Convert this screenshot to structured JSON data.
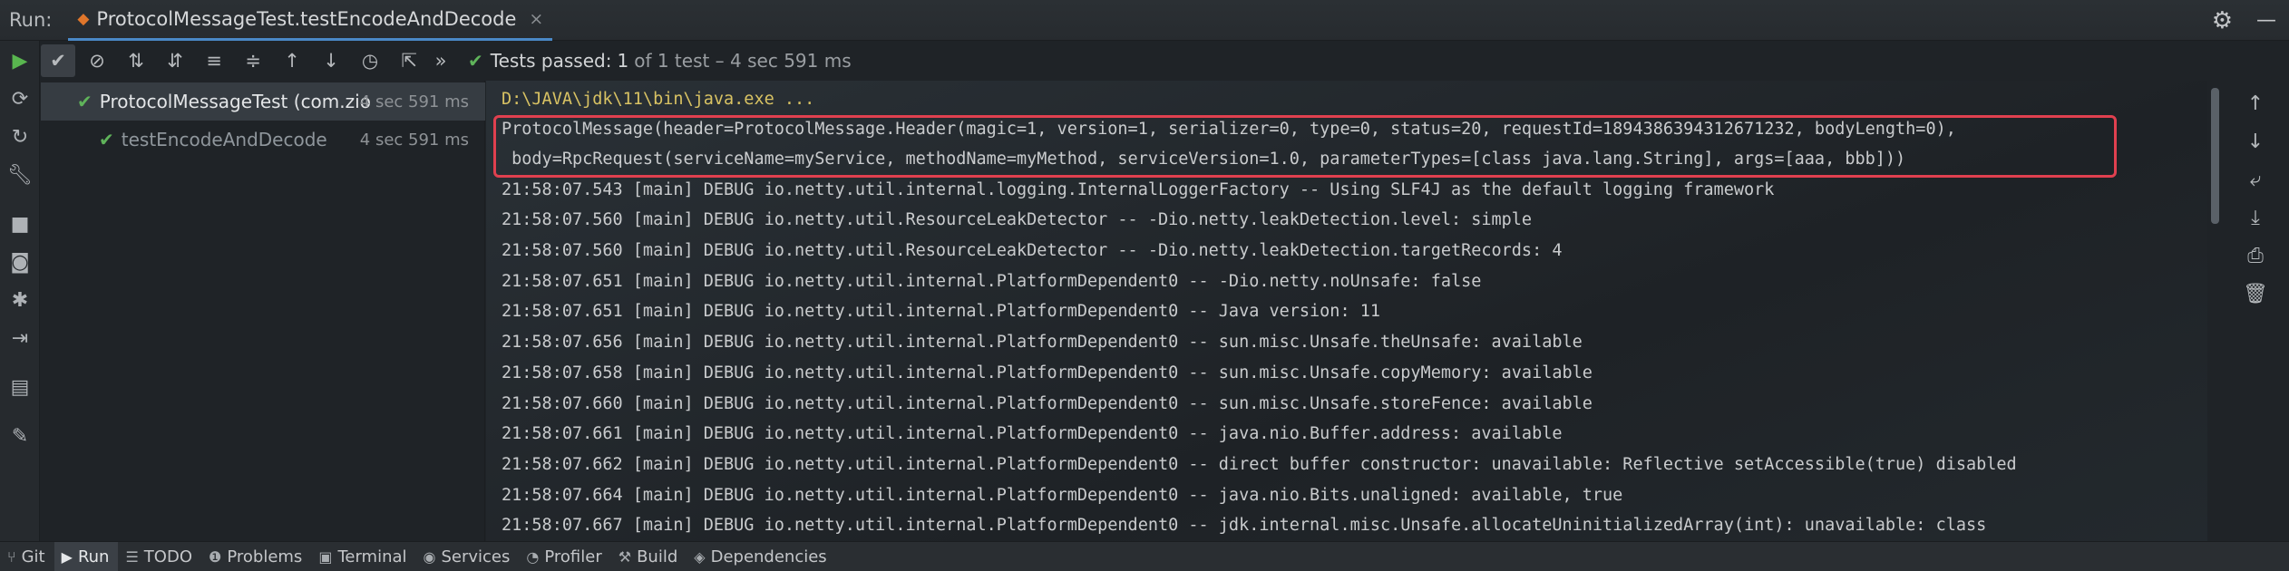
{
  "titlebar": {
    "run_label": "Run:",
    "tab_title": "ProtocolMessageTest.testEncodeAndDecode",
    "tab_close": "×",
    "settings_icon": "⚙",
    "minimize_icon": "—"
  },
  "left_toolbar": {
    "icons": [
      "run-icon",
      "rerun-failed-icon",
      "restore-icon",
      "wrench-icon",
      "stop-icon",
      "camera-icon",
      "bug-icon",
      "exit-icon",
      "layout-icon",
      "pin-icon"
    ]
  },
  "test_toolbar": {
    "status_prefix": "Tests passed:",
    "status_count": "1",
    "status_detail": "of 1 test – 4 sec 591 ms",
    "more": "»"
  },
  "test_tree": {
    "items": [
      {
        "name": "ProtocolMessageTest (com.zio.z",
        "time": "4 sec 591 ms",
        "selected": true
      },
      {
        "name": "testEncodeAndDecode",
        "time": "4 sec 591 ms",
        "selected": false
      }
    ]
  },
  "console": {
    "command": "D:\\JAVA\\jdk\\11\\bin\\java.exe ...",
    "lines": [
      "ProtocolMessage(header=ProtocolMessage.Header(magic=1, version=1, serializer=0, type=0, status=20, requestId=1894386394312671232, bodyLength=0),",
      " body=RpcRequest(serviceName=myService, methodName=myMethod, serviceVersion=1.0, parameterTypes=[class java.lang.String], args=[aaa, bbb]))",
      "21:58:07.543 [main] DEBUG io.netty.util.internal.logging.InternalLoggerFactory -- Using SLF4J as the default logging framework",
      "21:58:07.560 [main] DEBUG io.netty.util.ResourceLeakDetector -- -Dio.netty.leakDetection.level: simple",
      "21:58:07.560 [main] DEBUG io.netty.util.ResourceLeakDetector -- -Dio.netty.leakDetection.targetRecords: 4",
      "21:58:07.651 [main] DEBUG io.netty.util.internal.PlatformDependent0 -- -Dio.netty.noUnsafe: false",
      "21:58:07.651 [main] DEBUG io.netty.util.internal.PlatformDependent0 -- Java version: 11",
      "21:58:07.656 [main] DEBUG io.netty.util.internal.PlatformDependent0 -- sun.misc.Unsafe.theUnsafe: available",
      "21:58:07.658 [main] DEBUG io.netty.util.internal.PlatformDependent0 -- sun.misc.Unsafe.copyMemory: available",
      "21:58:07.660 [main] DEBUG io.netty.util.internal.PlatformDependent0 -- sun.misc.Unsafe.storeFence: available",
      "21:58:07.661 [main] DEBUG io.netty.util.internal.PlatformDependent0 -- java.nio.Buffer.address: available",
      "21:58:07.662 [main] DEBUG io.netty.util.internal.PlatformDependent0 -- direct buffer constructor: unavailable: Reflective setAccessible(true) disabled",
      "21:58:07.664 [main] DEBUG io.netty.util.internal.PlatformDependent0 -- java.nio.Bits.unaligned: available, true",
      "21:58:07.667 [main] DEBUG io.netty.util.internal.PlatformDependent0 -- jdk.internal.misc.Unsafe.allocateUninitializedArray(int): unavailable: class"
    ]
  },
  "bottombar": {
    "items": [
      {
        "label": "Git",
        "icon": "⑂"
      },
      {
        "label": "Run",
        "icon": "▶"
      },
      {
        "label": "TODO",
        "icon": "☰"
      },
      {
        "label": "Problems",
        "icon": "❶"
      },
      {
        "label": "Terminal",
        "icon": "▣"
      },
      {
        "label": "Services",
        "icon": "◉"
      },
      {
        "label": "Profiler",
        "icon": "◔"
      },
      {
        "label": "Build",
        "icon": "⚒"
      },
      {
        "label": "Dependencies",
        "icon": "◈"
      }
    ]
  },
  "colors": {
    "accent": "#4a88c7",
    "success": "#5fb35a",
    "highlight_border": "#e0404f",
    "command_text": "#d8c263"
  }
}
